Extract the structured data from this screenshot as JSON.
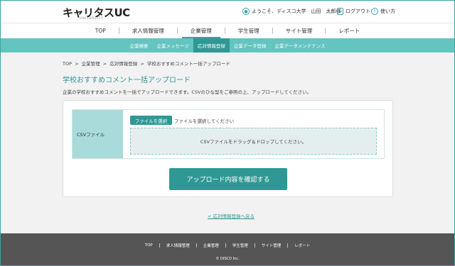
{
  "header": {
    "logo_main": "キャリタスUC",
    "logo_sub": "UNIVERSITY",
    "welcome_text": "ようこそ、ディスコ大学　山田　太郎様",
    "logout_label": "ログアウト",
    "help_label": "使い方"
  },
  "main_nav": {
    "items": [
      {
        "label": "TOP"
      },
      {
        "label": "求人情報管理"
      },
      {
        "label": "企業管理"
      },
      {
        "label": "学生管理"
      },
      {
        "label": "サイト管理"
      },
      {
        "label": "レポート"
      }
    ],
    "active_index": 2
  },
  "sub_nav": {
    "items": [
      {
        "label": "企業検索"
      },
      {
        "label": "企業メッセージ"
      },
      {
        "label": "応対情報登録"
      },
      {
        "label": "企業データ登録"
      },
      {
        "label": "企業データメンテナンス"
      }
    ],
    "active_index": 2
  },
  "breadcrumb": {
    "items": [
      "TOP",
      "企業管理",
      "応対情報登録",
      "学校おすすめコメント一括アップロード"
    ],
    "separator": ">"
  },
  "page": {
    "title": "学校おすすめコメント一括アップロード",
    "description": "企業の学校おすすめコメントを一括でアップロードできます。CSVのひな型をご参照の上、アップロードしてください。"
  },
  "upload": {
    "label": "CSVファイル",
    "file_button": "ファイルを選択",
    "file_status": "ファイルを選択してください",
    "dropzone_text": "CSVファイルをドラッグ＆ドロップしてください。",
    "confirm_button": "アップロード内容を確認する"
  },
  "back_link": "< 応対情報登録へ戻る",
  "footer": {
    "items": [
      "TOP",
      "求人情報管理",
      "企業管理",
      "学生管理",
      "サイト管理",
      "レポート"
    ],
    "copyright": "© DISCO Inc."
  },
  "colors": {
    "accent": "#2f9894",
    "subnav": "#63c4c0",
    "label_bg": "#a8dbd9",
    "footer_bg": "#555555"
  }
}
